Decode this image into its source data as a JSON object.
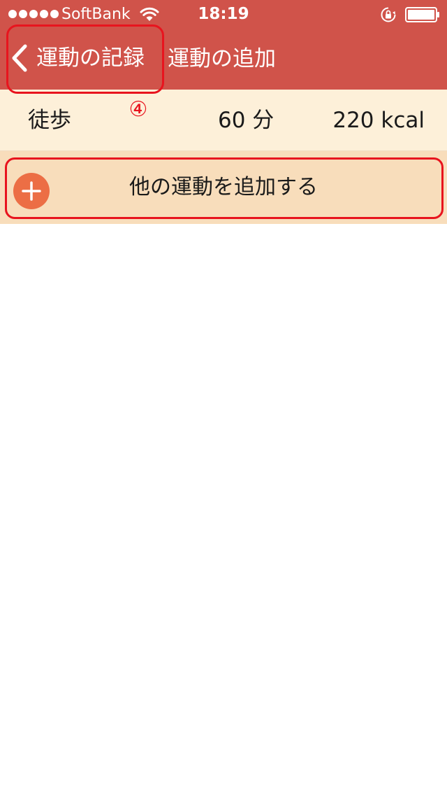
{
  "status_bar": {
    "carrier": "SoftBank",
    "time": "18:19"
  },
  "nav": {
    "back_label": "運動の記録",
    "title": "運動の追加"
  },
  "annotation": {
    "marker": "④",
    "color": "#e8141e"
  },
  "exercise": {
    "name": "徒歩",
    "duration": "60 分",
    "calories": "220 kcal"
  },
  "add_row": {
    "label": "他の運動を追加する"
  },
  "colors": {
    "header": "#d0534a",
    "exercise_row": "#fdf0d9",
    "add_row": "#f8ddbb",
    "plus_button": "#ec6e45"
  },
  "icons": [
    "wifi-icon",
    "rotation-lock-icon",
    "battery-icon",
    "chevron-left-icon",
    "plus-circle-icon"
  ]
}
